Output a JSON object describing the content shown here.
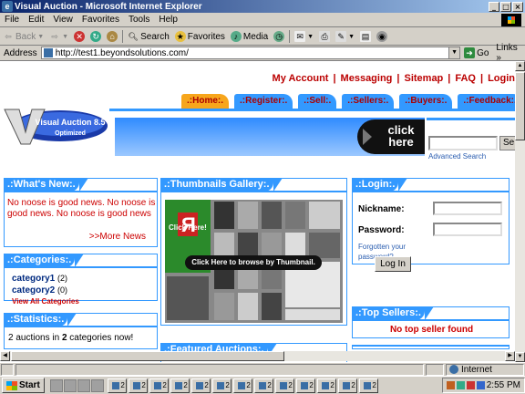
{
  "window": {
    "title": "Visual Auction - Microsoft Internet Explorer",
    "minimize": "_",
    "maximize": "□",
    "close": "×"
  },
  "menu": [
    "File",
    "Edit",
    "View",
    "Favorites",
    "Tools",
    "Help"
  ],
  "toolbar": {
    "back": "Back",
    "search": "Search",
    "favorites": "Favorites",
    "media": "Media"
  },
  "address": {
    "label": "Address",
    "url": "http://test1.beyondsolutions.com/",
    "go": "Go",
    "links": "Links"
  },
  "site": {
    "topnav": [
      "My Account",
      "Messaging",
      "Sitemap",
      "FAQ",
      "Login"
    ],
    "tabs": [
      ".:Home:.",
      ".:Register:.",
      ".:Sell:.",
      ".:Sellers:.",
      ".:Buyers:.",
      ".:Feedback:."
    ],
    "logo_name": "Visual Auction 8.5",
    "logo_tagline": "Optimized",
    "banner_click": "click here",
    "search_button": "Se",
    "advanced_search": "Advanced Search",
    "whats_new": {
      "title": ".:What's New:.",
      "text": "No noose is good news. No noose is good news. No noose is good news",
      "more": ">>More News"
    },
    "categories": {
      "title": ".:Categories:.",
      "items": [
        {
          "name": "category1",
          "count": "(2)"
        },
        {
          "name": "category2",
          "count": "(0)"
        }
      ],
      "view_all": "View All Categories"
    },
    "statistics": {
      "title": ".:Statistics:.",
      "auctions": "2",
      "mid": "auctions in",
      "categories": "2",
      "end": "categories now!"
    },
    "gallery": {
      "title": ".:Thumbnails Gallery:.",
      "overlay": "Click Here to browse by Thumbnail.",
      "click_here": "Click Here!"
    },
    "featured": {
      "title": ".:Featured Auctions:."
    },
    "login": {
      "title": ".:Login:.",
      "nickname_label": "Nickname:",
      "password_label": "Password:",
      "forgot": "Forgotten your password?",
      "button": "Log In"
    },
    "top_sellers": {
      "title": ".:Top Sellers:.",
      "empty": "No top seller found"
    }
  },
  "status": {
    "zone": "Internet"
  },
  "taskbar": {
    "start": "Start",
    "buttons": [
      "2",
      "2",
      "2",
      "2",
      "2",
      "2",
      "2",
      "2",
      "2",
      "2",
      "2",
      "2",
      "2"
    ],
    "clock": "2:55 PM"
  }
}
